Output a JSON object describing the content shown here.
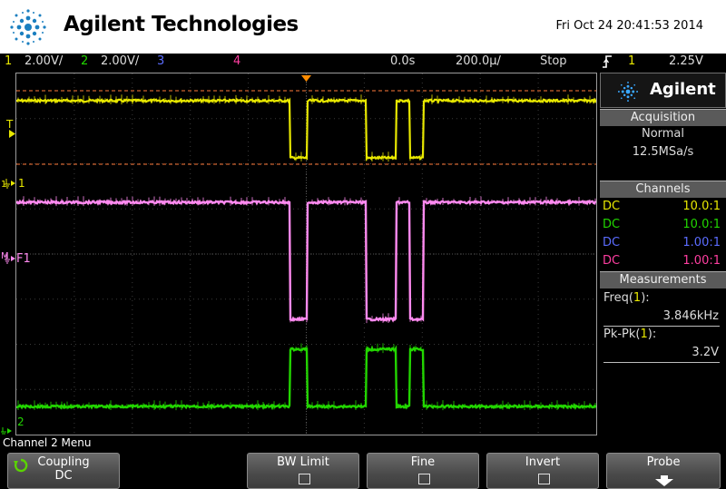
{
  "header": {
    "brand": "Agilent Technologies",
    "datetime": "Fri Oct 24 20:41:53 2014"
  },
  "status": {
    "ch1_num": "1",
    "ch1_scale": "2.00V/",
    "ch2_num": "2",
    "ch2_scale": "2.00V/",
    "ch3_num": "3",
    "ch4_num": "4",
    "delay": "0.0s",
    "timebase": "200.0µ/",
    "run_state": "Stop",
    "trigger_icon": "rising-edge-trigger-icon",
    "trigger_source": "1",
    "trigger_level": "2.25V"
  },
  "markers": {
    "trig_level": "T",
    "ch1": "1",
    "ch1_ground": "⏚",
    "f1": "F1",
    "ch2": "2"
  },
  "side": {
    "brand": "Agilent",
    "acquisition_title": "Acquisition",
    "acq_mode": "Normal",
    "acq_rate": "12.5MSa/s",
    "channels_title": "Channels",
    "channels": [
      {
        "coupling": "DC",
        "ratio": "10.0:1"
      },
      {
        "coupling": "DC",
        "ratio": "10.0:1"
      },
      {
        "coupling": "DC",
        "ratio": "1.00:1"
      },
      {
        "coupling": "DC",
        "ratio": "1.00:1"
      }
    ],
    "measurements_title": "Measurements",
    "m1_name": "Freq(",
    "m1_src": "1",
    "m1_close": "):",
    "m1_value": "3.846kHz",
    "m2_name": "Pk-Pk(",
    "m2_src": "1",
    "m2_close": "):",
    "m2_value": "3.2V"
  },
  "menu": {
    "title": "Channel 2 Menu",
    "coupling_label": "Coupling",
    "coupling_value": "DC",
    "bwlimit_label": "BW Limit",
    "fine_label": "Fine",
    "invert_label": "Invert",
    "probe_label": "Probe"
  },
  "colors": {
    "ch1": "#e8e800",
    "ch2": "#22d600",
    "ch3": "#5b6cff",
    "ch4": "#ff3ea1",
    "function": "#ff8af0",
    "trigger_marker": "#ff8c00"
  },
  "waveforms": {
    "ch1_low_intervals": [
      [
        0.472,
        0.501
      ],
      [
        0.604,
        0.655
      ],
      [
        0.679,
        0.702
      ]
    ],
    "f1_low_intervals": [
      [
        0.472,
        0.501
      ],
      [
        0.604,
        0.655
      ],
      [
        0.679,
        0.702
      ]
    ],
    "ch2_high_intervals": [
      [
        0.472,
        0.501
      ],
      [
        0.604,
        0.655
      ],
      [
        0.679,
        0.702
      ]
    ]
  }
}
